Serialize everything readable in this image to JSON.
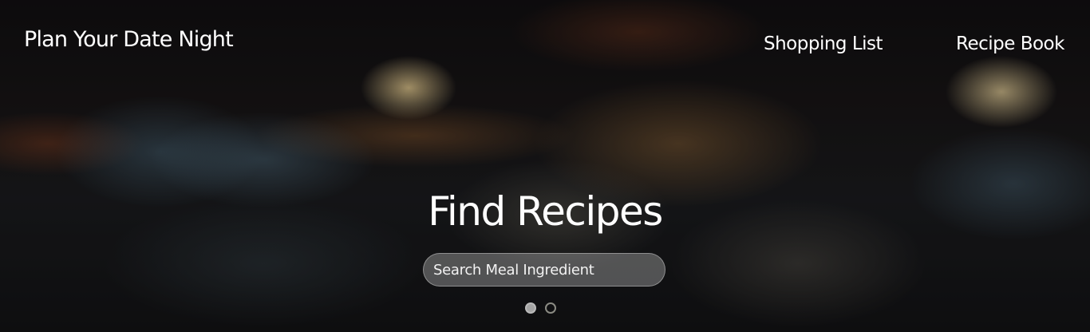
{
  "navbar": {
    "brand": "Plan Your Date Night",
    "links": [
      {
        "label": "Shopping List"
      },
      {
        "label": "Recipe Book"
      }
    ]
  },
  "hero": {
    "headline": "Find Recipes",
    "search": {
      "placeholder": "Search Meal Ingredient",
      "value": ""
    },
    "carousel": {
      "slides": 2,
      "active_index": 0
    }
  },
  "colors": {
    "text": "#ffffff",
    "background": "#0b0a0a"
  }
}
